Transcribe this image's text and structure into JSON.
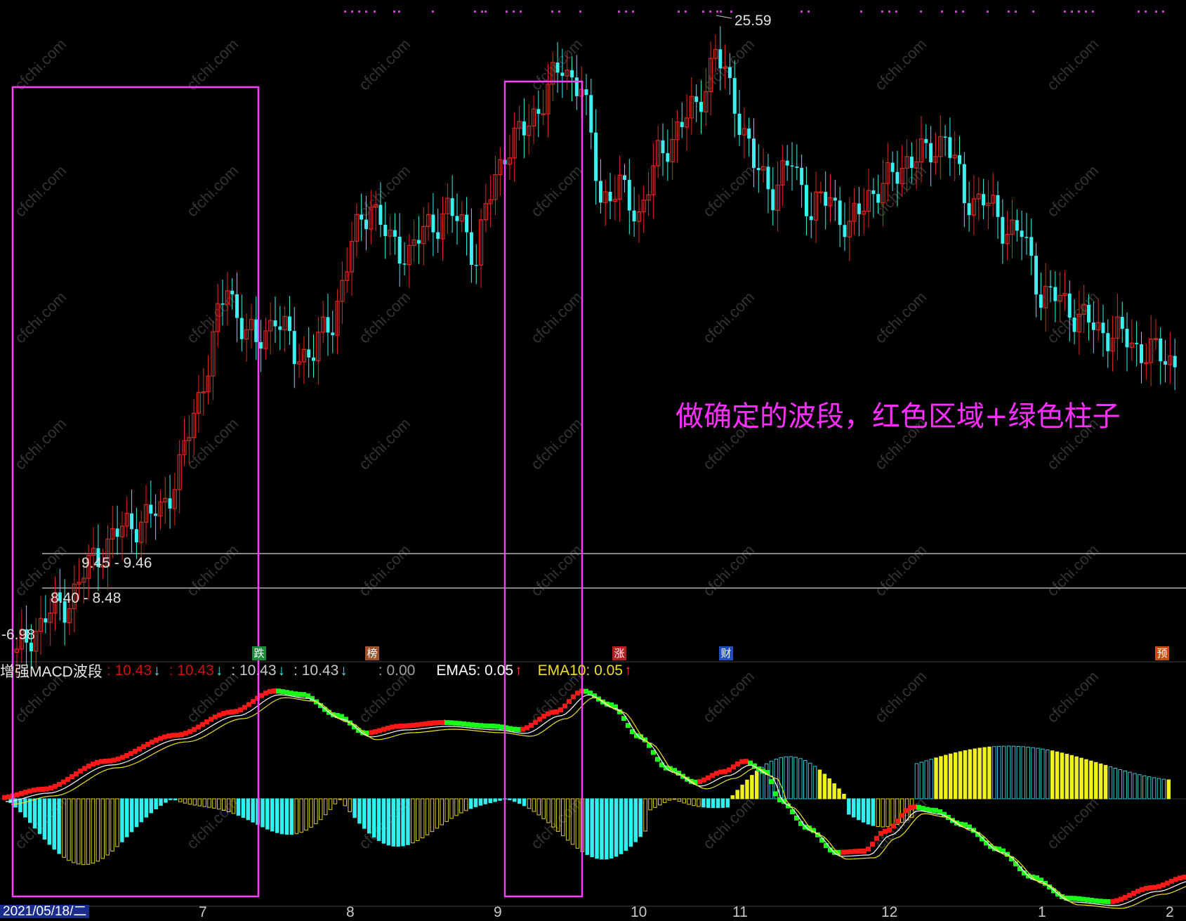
{
  "chart_data": {
    "type": "candlestick",
    "price_max_label": "25.59",
    "price_min_label": "-6.98",
    "levels": [
      {
        "label": "9.45 - 9.46",
        "value": 9.45
      },
      {
        "label": "8.40 - 8.48",
        "value": 8.44
      }
    ],
    "annotation": "做确定的波段，红色区域+绿色柱子",
    "indicator": {
      "name": "增强MACD波段",
      "items": [
        {
          "text": ": 10.43",
          "arrow": "↓",
          "color": "#d01010"
        },
        {
          "text": ": 10.43",
          "arrow": "↓",
          "color": "#d01010"
        },
        {
          "text": ": 10.43",
          "arrow": "↓",
          "color": "#c8c8c8"
        },
        {
          "text": ": 10.43",
          "arrow": "↓",
          "color": "#c8c8c8"
        },
        {
          "text": ": 0.00",
          "arrow": "",
          "color": "#c8c8c8"
        }
      ],
      "ema5": {
        "label": "EMA5: 0.05",
        "arrow": "↑",
        "color": "#ffffff"
      },
      "ema10": {
        "label": "EMA10: 0.05",
        "arrow": "↑",
        "color": "#f0e020"
      }
    },
    "events": [
      {
        "glyph": "跌",
        "color": "#1e8a3c"
      },
      {
        "glyph": "榜",
        "color": "#a0522d"
      },
      {
        "glyph": "涨",
        "color": "#b02020"
      },
      {
        "glyph": "财",
        "color": "#2050c0"
      },
      {
        "glyph": "预",
        "color": "#c05010"
      }
    ],
    "x_axis": {
      "first_date": "2021/05/18/二",
      "ticks": [
        "7",
        "8",
        "9",
        "10",
        "11",
        "12",
        "1",
        "2"
      ]
    },
    "watermark": "cfchi.com",
    "colors": {
      "up": "#e0281e",
      "down": "#3cf0f0",
      "frame": "#ff40ff",
      "hist_neg_solid": "#30f0f0",
      "hist_neg_hollow": "#e0d020",
      "hist_pos_solid": "#f0f020",
      "hist_pos_hollow": "#30c8d8",
      "macd_red": "#ff1818",
      "macd_green": "#18ff18"
    }
  }
}
